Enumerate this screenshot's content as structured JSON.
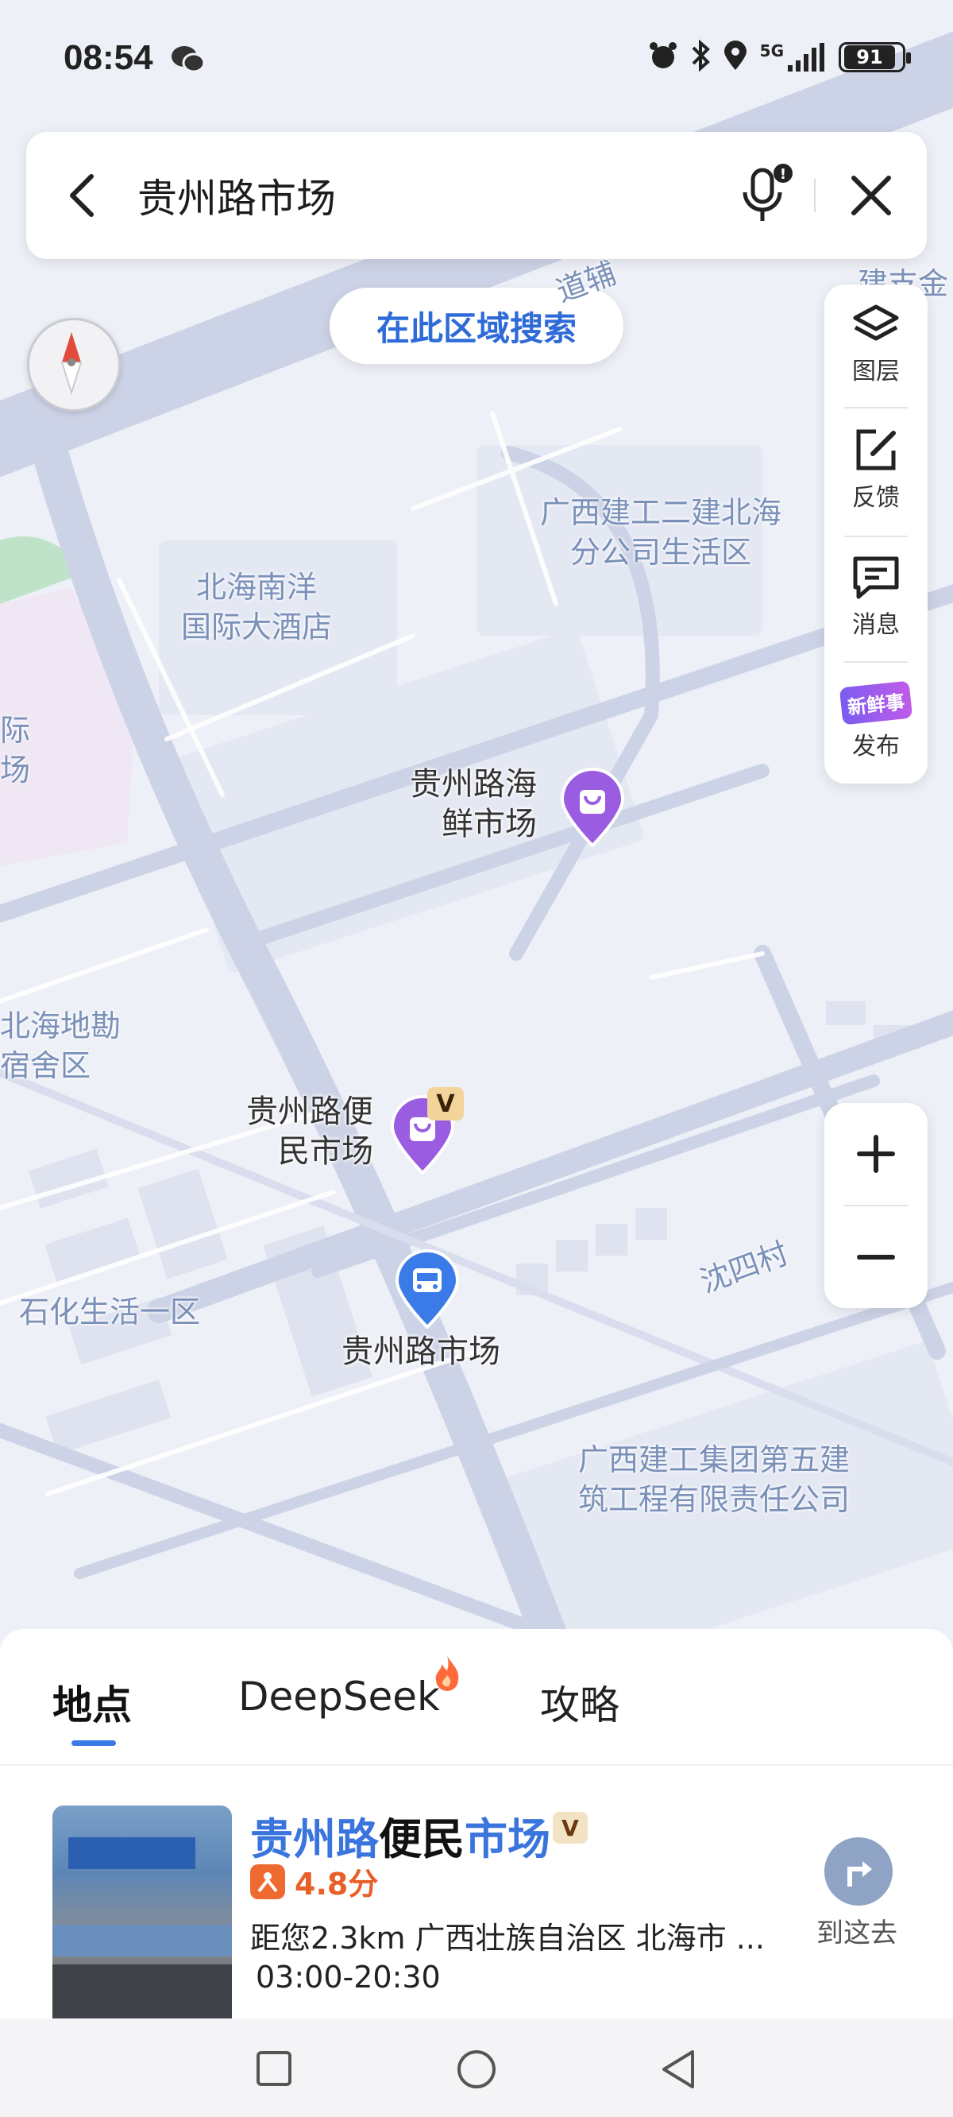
{
  "status_bar": {
    "time": "08:54",
    "signal": "5G",
    "battery": "91"
  },
  "search": {
    "query": "贵州路市场"
  },
  "map": {
    "area_search_button": "在此区域搜索",
    "tools": [
      {
        "label": "图层",
        "icon": "layers-icon"
      },
      {
        "label": "反馈",
        "icon": "edit-feedback-icon"
      },
      {
        "label": "消息",
        "icon": "message-icon"
      },
      {
        "label": "发布",
        "icon": "new-things-badge-icon",
        "badge_text": "新鲜事"
      }
    ],
    "road_label_top": "道辅",
    "road_label_corner": "建支金",
    "road_label_shensi": "沈四村",
    "area_labels": {
      "guangxi_jiangong_2": [
        "广西建工二建北海",
        "分公司生活区"
      ],
      "beihai_nanyang": [
        "北海南洋",
        "国际大酒店"
      ],
      "left_edge": [
        "际",
        "场"
      ],
      "beihai_dikan": [
        "北海地勘",
        "宿舍区"
      ],
      "shihua": "石化生活一区",
      "guangxi_jiangong_5": [
        "广西建工集团第五建",
        "筑工程有限责任公司"
      ]
    },
    "pois": {
      "seafood_market": [
        "贵州路海",
        "鲜市场"
      ],
      "convenience_market": [
        "贵州路便",
        "民市场"
      ],
      "bus_stop": "贵州路市场",
      "convenience_badge": "V"
    },
    "colors": {
      "poi_purple": "#9a5ce0",
      "poi_blue": "#3b7be8",
      "road": "#cdd3e6",
      "block": "#e6e9f3"
    }
  },
  "bottom_sheet": {
    "tabs": [
      {
        "label": "地点",
        "active": true
      },
      {
        "label": "DeepSeek",
        "active": false,
        "hot": true
      },
      {
        "label": "攻略",
        "active": false
      }
    ],
    "result": {
      "title_parts": [
        {
          "text": "贵州路",
          "highlight": true
        },
        {
          "text": "便民",
          "highlight": false
        },
        {
          "text": "市场",
          "highlight": true
        }
      ],
      "badge": "V",
      "rating": "4.8分",
      "distance": "距您2.3km  广西壮族自治区 北海市 ...",
      "hours": "03:00-20:30",
      "go_label": "到这去"
    }
  },
  "nav_bar": {
    "buttons": [
      "recent-apps",
      "home",
      "back"
    ]
  }
}
